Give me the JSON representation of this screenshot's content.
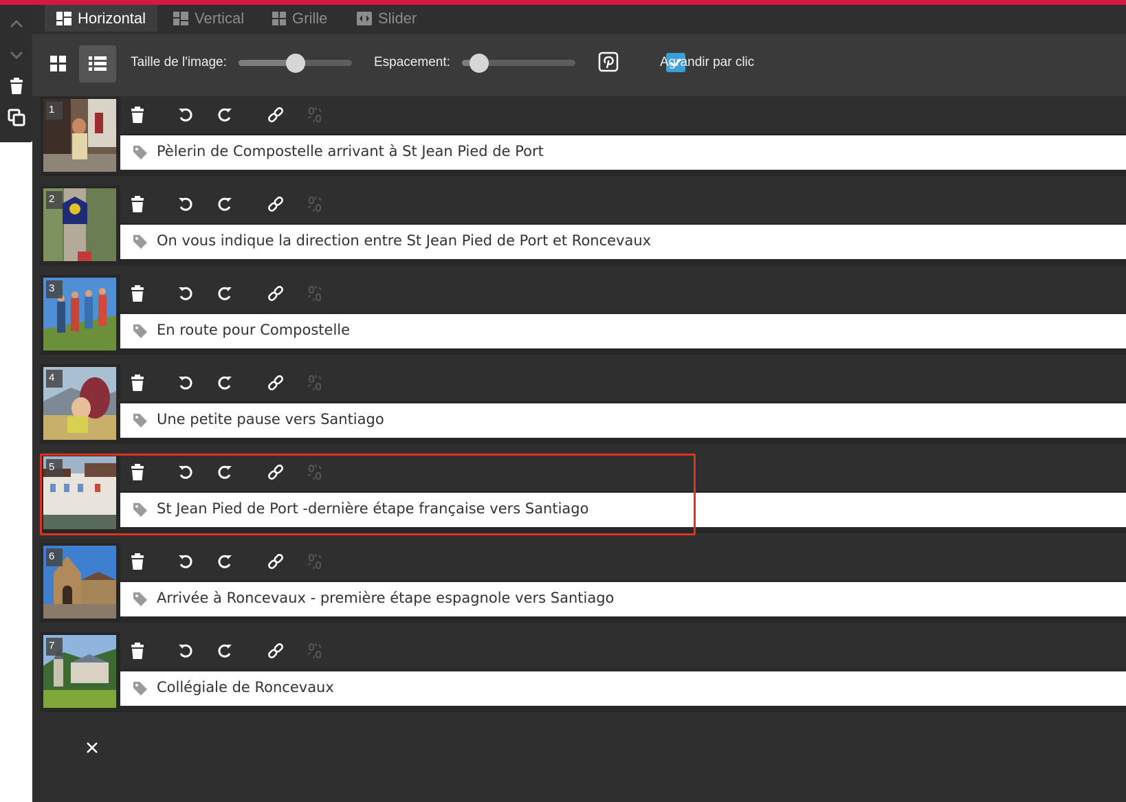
{
  "tabs": [
    {
      "label": "Horizontal",
      "active": true
    },
    {
      "label": "Vertical",
      "active": false
    },
    {
      "label": "Grille",
      "active": false
    },
    {
      "label": "Slider",
      "active": false
    }
  ],
  "toolbar": {
    "image_size_label": "Taille de l'image:",
    "image_size_value": 0.5,
    "spacing_label": "Espacement:",
    "spacing_value": 0.15,
    "enlarge_label": "Agrandir par clic",
    "enlarge_checked": true
  },
  "images": [
    {
      "number": "1",
      "caption": "Pèlerin de Compostelle arrivant à St Jean Pied de Port"
    },
    {
      "number": "2",
      "caption": "On vous indique la direction entre St Jean Pied de Port et Roncevaux"
    },
    {
      "number": "3",
      "caption": "En route pour Compostelle"
    },
    {
      "number": "4",
      "caption": "Une petite pause vers Santiago"
    },
    {
      "number": "5",
      "caption": "St Jean Pied de Port -dernière étape française vers Santiago",
      "highlighted": true
    },
    {
      "number": "6",
      "caption": "Arrivée à Roncevaux - première étape espagnole vers Santiago"
    },
    {
      "number": "7",
      "caption": "Collégiale de Roncevaux"
    }
  ],
  "icons": {
    "left_panel": [
      "chevron-up-icon",
      "chevron-down-icon",
      "trash-icon",
      "copy-icon"
    ],
    "row_actions": [
      "trash-icon",
      "rotate-left-icon",
      "rotate-right-icon",
      "link-icon",
      "unlink-icon"
    ],
    "caption": "tag-icon",
    "close": "close-icon"
  },
  "colors": {
    "accent_bar": "#d8193f",
    "checkbox": "#3d9fd9",
    "highlight_box": "#e0321e"
  }
}
